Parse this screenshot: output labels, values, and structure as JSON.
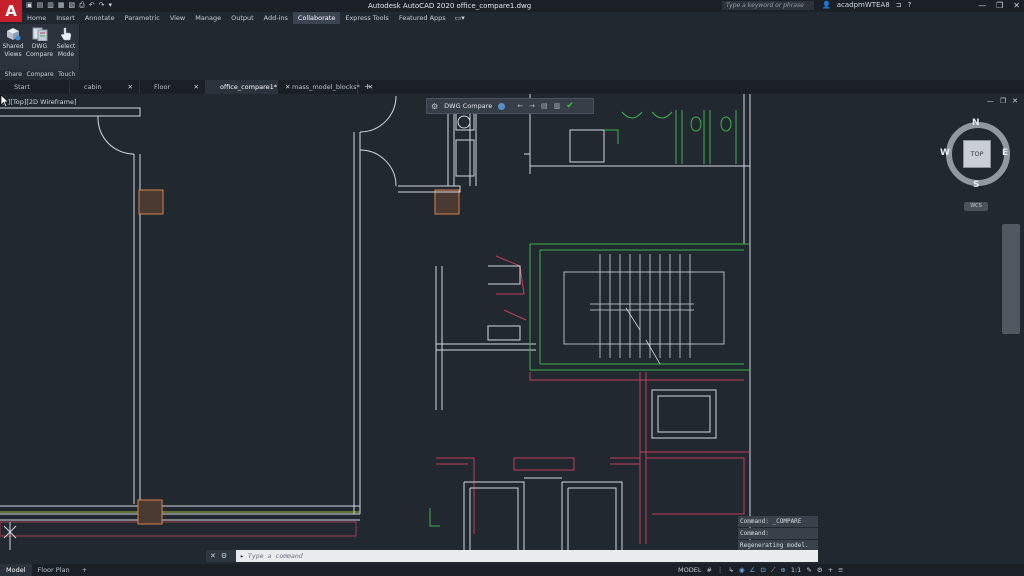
{
  "title_bar": {
    "logo": "A",
    "title": "Autodesk AutoCAD 2020   office_compare1.dwg",
    "qat_icons": [
      "▣",
      "▤",
      "▥",
      "▦",
      "▧",
      "⎙",
      "↶",
      "↷",
      "▾"
    ],
    "search_placeholder": "Type a keyword or phrase",
    "user": "acadpmWTEA8",
    "cart": "⊐",
    "help": "?",
    "window_controls": [
      "—",
      "❐",
      "✕"
    ]
  },
  "ribbon": {
    "tabs": [
      "Home",
      "Insert",
      "Annotate",
      "Parametric",
      "View",
      "Manage",
      "Output",
      "Add-ins",
      "Collaborate",
      "Express Tools",
      "Featured Apps"
    ],
    "active_tab": "Collaborate",
    "extra": "▭▾",
    "buttons": [
      {
        "line1": "Shared",
        "line2": "Views"
      },
      {
        "line1": "DWG",
        "line2": "Compare"
      },
      {
        "line1": "Select",
        "line2": "Mode"
      }
    ],
    "panel_labels": [
      "Share",
      "Compare",
      "Touch"
    ]
  },
  "file_tabs": [
    {
      "label": "Start",
      "close": ""
    },
    {
      "label": "cabin elevation",
      "close": "✕"
    },
    {
      "label": "Floor Plan",
      "close": "✕"
    },
    {
      "label": "office_compare1*",
      "close": "✕"
    },
    {
      "label": "mass_model_blocks*",
      "close": "✕"
    }
  ],
  "active_file_tab": 3,
  "file_tab_add": "+",
  "viewport": {
    "label": "[–][Top][2D Wireframe]",
    "controls": [
      "—",
      "❐",
      "✕"
    ]
  },
  "compare_toolbar": {
    "label": "DWG Compare",
    "gear": "⚙",
    "prev": "←",
    "next": "→",
    "icon1": "▤",
    "icon2": "▥",
    "ok": "✔"
  },
  "viewcube": {
    "top": "TOP",
    "n": "N",
    "s": "S",
    "e": "E",
    "w": "W",
    "wcs": "WCS"
  },
  "command_history": [
    "Command: _COMPARE",
    "Command:",
    "Regenerating model."
  ],
  "command_line": {
    "placeholder": "Type a command",
    "prompt": "▸",
    "btn_close": "✕",
    "btn_tool": "⚙"
  },
  "status_bar": {
    "tabs": [
      "Model",
      "Floor Plan"
    ],
    "active_tab": "Model",
    "add": "+",
    "model_label": "MODEL",
    "zoom": "1:1",
    "icons": [
      "#",
      "⋮",
      "↳",
      "◉",
      "∠",
      "⊡",
      "⟋",
      "⊕",
      "✎",
      "⚙",
      "+",
      "≡"
    ]
  },
  "colors": {
    "background": "#212830",
    "wall": "#d4d9de",
    "green_added": "#3bb34a",
    "red_removed": "#c2405a",
    "column": "#d9844a"
  }
}
